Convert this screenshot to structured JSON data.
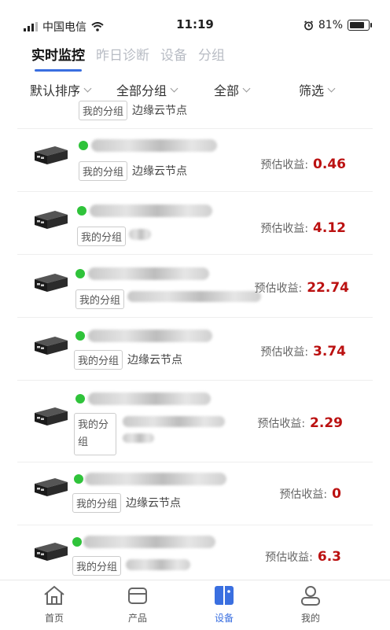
{
  "status": {
    "carrier": "中国电信",
    "time": "11:19",
    "battery": "81%"
  },
  "tabs": [
    "实时监控",
    "昨日诊断",
    "设备",
    "分组"
  ],
  "filters": [
    "默认排序",
    "全部分组",
    "全部",
    "筛选"
  ],
  "partial_row": {
    "group": "我的分组",
    "node": "边缘云节点"
  },
  "rows": [
    {
      "group": "我的分组",
      "node": "边缘云节点",
      "earn_label": "预估收益:",
      "earn_value": "0.46"
    },
    {
      "group": "我的分组",
      "node": "",
      "earn_label": "预估收益:",
      "earn_value": "4.12"
    },
    {
      "group": "我的分组",
      "node": "",
      "earn_label": "预估收益:",
      "earn_value": "22.74"
    },
    {
      "group": "我的分组",
      "node": "边缘云节点",
      "earn_label": "预估收益:",
      "earn_value": "3.74"
    },
    {
      "group": "我的分组",
      "node": "",
      "earn_label": "预估收益:",
      "earn_value": "2.29"
    },
    {
      "group": "我的分组",
      "node": "边缘云节点",
      "earn_label": "预估收益:",
      "earn_value": "0"
    },
    {
      "group": "我的分组",
      "node": "",
      "earn_label": "预估收益:",
      "earn_value": "6.3"
    }
  ],
  "nav": [
    "首页",
    "产品",
    "设备",
    "我的"
  ],
  "colors": {
    "accent": "#3a6fe0",
    "online": "#2fc33a",
    "earning": "#bb1111"
  }
}
